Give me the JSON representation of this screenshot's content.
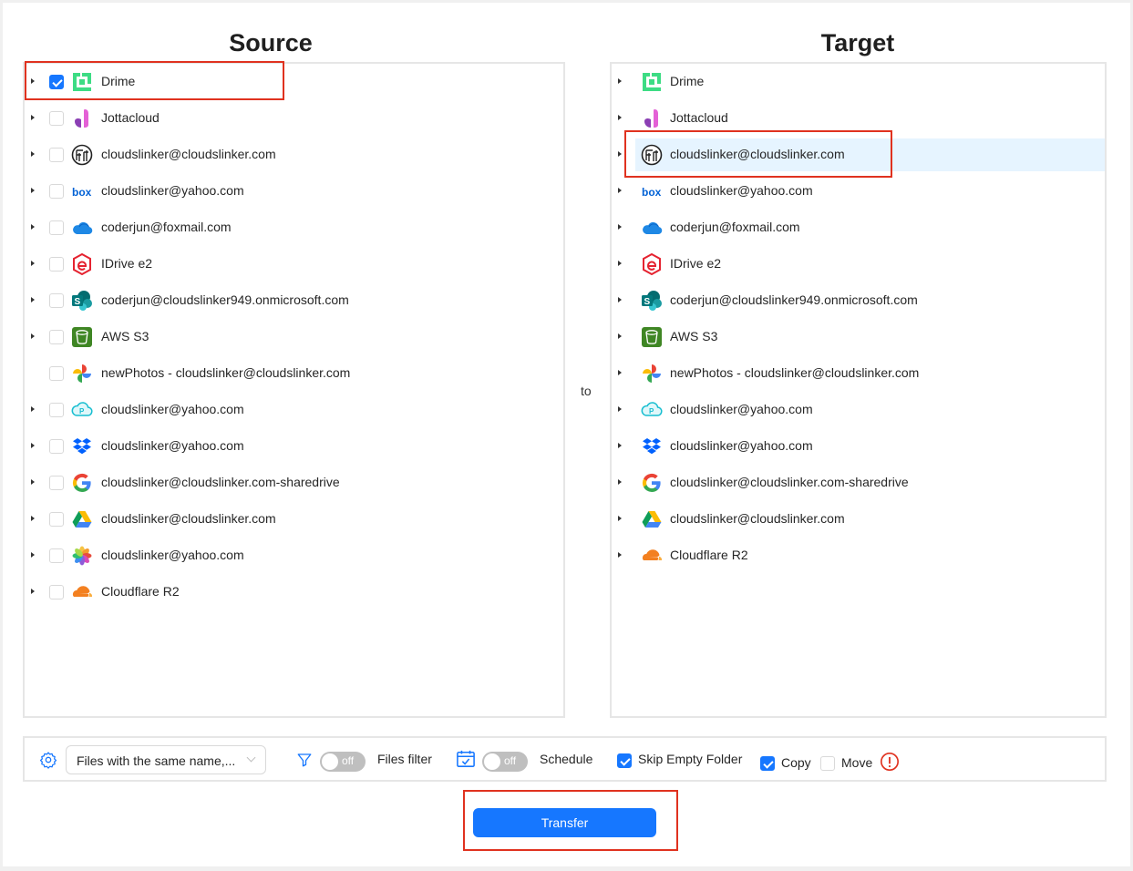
{
  "source": {
    "title": "Source",
    "items": [
      {
        "label": "Drime",
        "icon": "drime-icon",
        "checked": true,
        "expandable": true
      },
      {
        "label": "Jottacloud",
        "icon": "jottacloud-icon",
        "checked": false,
        "expandable": true
      },
      {
        "label": "cloudslinker@cloudslinker.com",
        "icon": "filen-icon",
        "checked": false,
        "expandable": true
      },
      {
        "label": "cloudslinker@yahoo.com",
        "icon": "box-icon",
        "checked": false,
        "expandable": true
      },
      {
        "label": "coderjun@foxmail.com",
        "icon": "onedrive-icon",
        "checked": false,
        "expandable": true
      },
      {
        "label": "IDrive e2",
        "icon": "idrive-icon",
        "checked": false,
        "expandable": true
      },
      {
        "label": "coderjun@cloudslinker949.onmicrosoft.com",
        "icon": "sharepoint-icon",
        "checked": false,
        "expandable": true
      },
      {
        "label": "AWS S3",
        "icon": "aws-s3-icon",
        "checked": false,
        "expandable": true
      },
      {
        "label": "newPhotos - cloudslinker@cloudslinker.com",
        "icon": "google-photos-icon",
        "checked": false,
        "expandable": false
      },
      {
        "label": "cloudslinker@yahoo.com",
        "icon": "pcloud-icon",
        "checked": false,
        "expandable": true
      },
      {
        "label": "cloudslinker@yahoo.com",
        "icon": "dropbox-icon",
        "checked": false,
        "expandable": true
      },
      {
        "label": "cloudslinker@cloudslinker.com-sharedrive",
        "icon": "google-icon",
        "checked": false,
        "expandable": true
      },
      {
        "label": "cloudslinker@cloudslinker.com",
        "icon": "google-drive-icon",
        "checked": false,
        "expandable": true
      },
      {
        "label": "cloudslinker@yahoo.com",
        "icon": "photos-icon",
        "checked": false,
        "expandable": true
      },
      {
        "label": "Cloudflare R2",
        "icon": "cloudflare-icon",
        "checked": false,
        "expandable": true
      }
    ]
  },
  "target": {
    "title": "Target",
    "items": [
      {
        "label": "Drime",
        "icon": "drime-icon"
      },
      {
        "label": "Jottacloud",
        "icon": "jottacloud-icon"
      },
      {
        "label": "cloudslinker@cloudslinker.com",
        "icon": "filen-icon",
        "selected": true
      },
      {
        "label": "cloudslinker@yahoo.com",
        "icon": "box-icon"
      },
      {
        "label": "coderjun@foxmail.com",
        "icon": "onedrive-icon"
      },
      {
        "label": "IDrive e2",
        "icon": "idrive-icon"
      },
      {
        "label": "coderjun@cloudslinker949.onmicrosoft.com",
        "icon": "sharepoint-icon"
      },
      {
        "label": "AWS S3",
        "icon": "aws-s3-icon"
      },
      {
        "label": "newPhotos - cloudslinker@cloudslinker.com",
        "icon": "google-photos-icon"
      },
      {
        "label": "cloudslinker@yahoo.com",
        "icon": "pcloud-icon"
      },
      {
        "label": "cloudslinker@yahoo.com",
        "icon": "dropbox-icon"
      },
      {
        "label": "cloudslinker@cloudslinker.com-sharedrive",
        "icon": "google-icon"
      },
      {
        "label": "cloudslinker@cloudslinker.com",
        "icon": "google-drive-icon"
      },
      {
        "label": "Cloudflare R2",
        "icon": "cloudflare-icon"
      }
    ]
  },
  "to_label": "to",
  "toolbar": {
    "conflict_select": "Files with the same name,...",
    "filter_switch": "off",
    "filter_label": "Files filter",
    "schedule_switch": "off",
    "schedule_label": "Schedule",
    "skip_empty_label": "Skip Empty Folder",
    "skip_empty_checked": true,
    "copy_label": "Copy",
    "copy_checked": true,
    "move_label": "Move",
    "move_checked": false
  },
  "transfer_button": "Transfer",
  "colors": {
    "accent": "#1677ff",
    "highlight": "#e0321f",
    "selected_row": "#e6f4ff"
  }
}
